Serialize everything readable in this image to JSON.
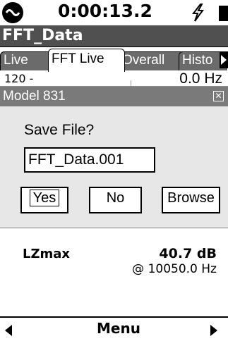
{
  "status": {
    "timer": "0:00:13.2",
    "icons": [
      "logo-icon",
      "bolt-icon",
      "battery-icon"
    ]
  },
  "title": "FFT_Data",
  "tabs": [
    {
      "label": "Live",
      "active": false
    },
    {
      "label": "FFT Live",
      "active": true
    },
    {
      "label": "Overall",
      "active": false
    },
    {
      "label": "Histo",
      "active": false
    }
  ],
  "header": {
    "left": "120 -",
    "right": "0.0 Hz"
  },
  "dialog": {
    "title": "Model 831",
    "message": "Save File?",
    "filename": "FFT_Data.001",
    "buttons": {
      "yes": "Yes",
      "no": "No",
      "browse": "Browse"
    }
  },
  "readout": {
    "label": "LZmax",
    "value": "40.7 dB",
    "frequency": "@ 10050.0 Hz"
  },
  "bottom": {
    "menu": "Menu"
  },
  "colors": {
    "title_bar": "#505050",
    "tab_inactive": "#6b6b6b",
    "dialog_title": "#7a7a7a",
    "dialog_bg": "#e7e7e7"
  }
}
